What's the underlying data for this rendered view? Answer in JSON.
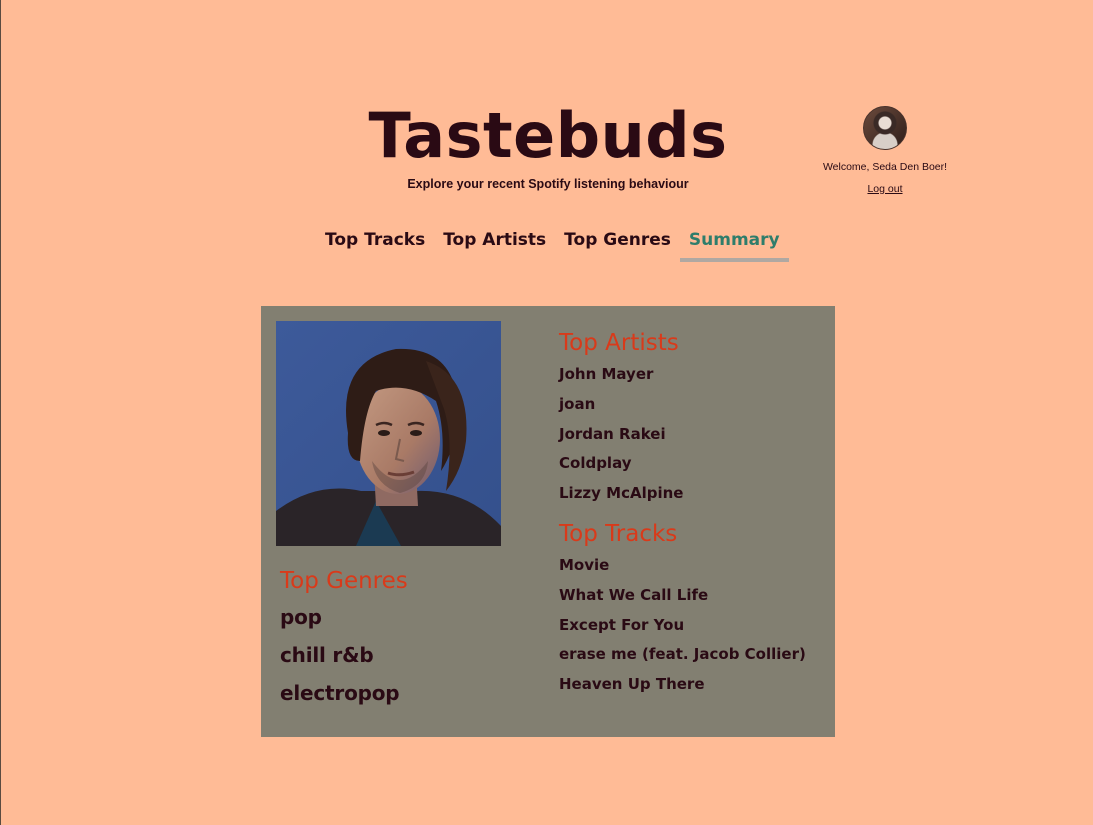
{
  "app": {
    "title": "Tastebuds",
    "subtitle": "Explore your recent Spotify listening behaviour"
  },
  "user": {
    "welcome": "Welcome, Seda Den Boer!",
    "logout_label": "Log out",
    "avatar_icon": "user-avatar"
  },
  "nav": {
    "items": [
      {
        "label": "Top Tracks",
        "active": false
      },
      {
        "label": "Top Artists",
        "active": false
      },
      {
        "label": "Top Genres",
        "active": false
      },
      {
        "label": "Summary",
        "active": true
      }
    ]
  },
  "summary": {
    "photo_icon": "artist-photo",
    "genres": {
      "heading": "Top Genres",
      "items": [
        "pop",
        "chill r&b",
        "electropop"
      ]
    },
    "artists": {
      "heading": "Top Artists",
      "items": [
        "John Mayer",
        "joan",
        "Jordan Rakei",
        "Coldplay",
        "Lizzy McAlpine"
      ]
    },
    "tracks": {
      "heading": "Top Tracks",
      "items": [
        "Movie",
        "What We Call Life",
        "Except For You",
        "erase me (feat. Jacob Collier)",
        "Heaven Up There"
      ]
    }
  },
  "colors": {
    "background": "#FFBB96",
    "card": "#827F71",
    "heading_accent": "#D93A1A",
    "nav_active": "#2E7D6B",
    "text": "#2a0a14"
  }
}
